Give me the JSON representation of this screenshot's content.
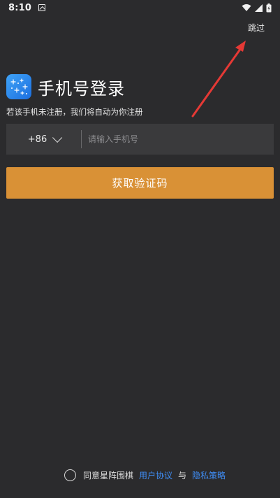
{
  "status_bar": {
    "time": "8:10"
  },
  "header": {
    "skip_label": "跳过"
  },
  "login": {
    "title": "手机号登录",
    "subtitle": "若该手机未注册，我们将自动为你注册",
    "country_code": "+86",
    "phone_placeholder": "请输入手机号",
    "phone_value": "",
    "submit_label": "获取验证码"
  },
  "agreement": {
    "prefix": "同意星阵围棋",
    "user_agreement": "用户协议",
    "conjunction": "与",
    "privacy_policy": "隐私策略",
    "link_color": "#3f8df5"
  },
  "colors": {
    "background": "#2b2b2d",
    "input_bg": "#3a3a3c",
    "accent": "#d99136",
    "annotation_arrow": "#e53935"
  },
  "icons": [
    "notification-icon",
    "wifi-icon",
    "signal-icon",
    "battery-icon",
    "app-logo-icon",
    "chevron-down-icon",
    "red-annotation-arrow"
  ]
}
